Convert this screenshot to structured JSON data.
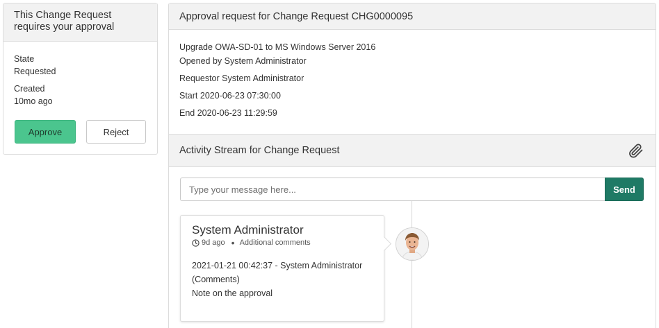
{
  "approval": {
    "title": "This Change Request requires your approval",
    "state_label": "State",
    "state_value": "Requested",
    "created_label": "Created",
    "created_value": "10mo ago",
    "approve_label": "Approve",
    "reject_label": "Reject"
  },
  "request": {
    "title": "Approval request for Change Request CHG0000095",
    "short_description": "Upgrade OWA-SD-01 to MS Windows Server 2016",
    "opened_by": "Opened by System Administrator",
    "requestor": "Requestor System Administrator",
    "start": "Start 2020-06-23 07:30:00",
    "end": "End 2020-06-23 11:29:59"
  },
  "activity": {
    "title": "Activity Stream for Change Request",
    "attachment_icon": "paperclip-icon",
    "message_placeholder": "Type your message here...",
    "send_label": "Send",
    "entries": [
      {
        "author": "System Administrator",
        "time_ago": "9d ago",
        "type": "Additional comments",
        "line1": "2021-01-21 00:42:37 - System Administrator",
        "line2": "(Comments)",
        "line3": "Note on the approval"
      }
    ]
  },
  "colors": {
    "approve": "#4bc58e",
    "send": "#1f7a65",
    "header_bg": "#f2f2f2"
  }
}
